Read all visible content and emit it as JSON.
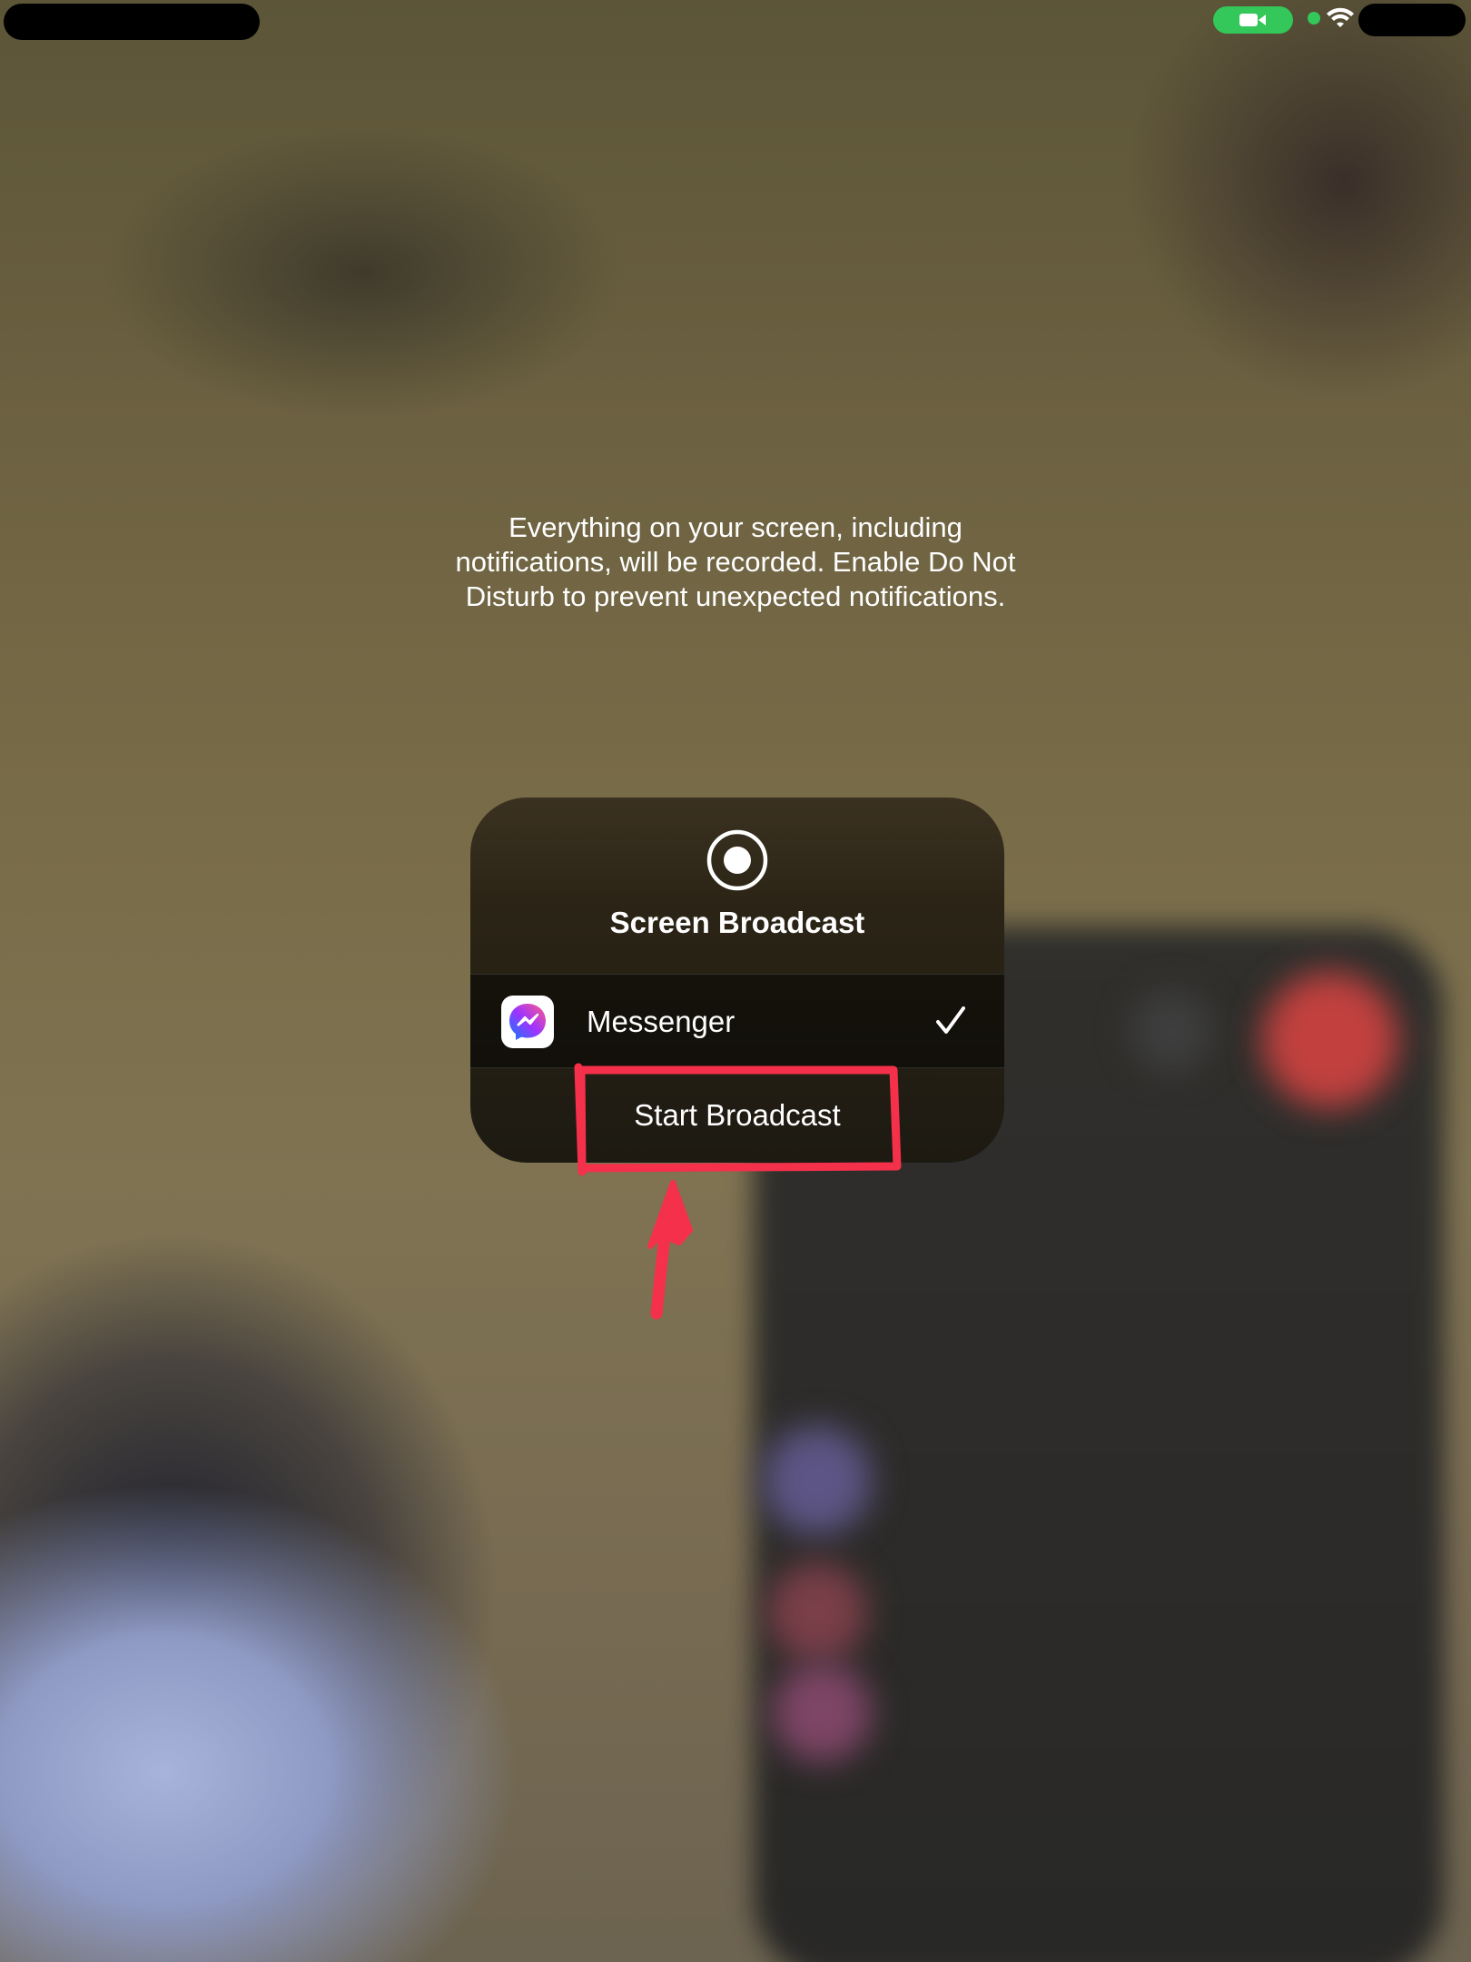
{
  "notice": {
    "text": "Everything on your screen, including notifications, will be recorded. Enable Do Not Disturb to prevent unexpected notifications."
  },
  "dialog": {
    "icon": "record-icon",
    "title": "Screen Broadcast",
    "selected_app": {
      "label": "Messenger",
      "icon": "messenger-icon",
      "selected_icon": "checkmark-icon"
    },
    "start_button_label": "Start Broadcast"
  },
  "status_bar": {
    "camera_indicator_icon": "video-camera-icon",
    "wifi_icon": "wifi-icon"
  },
  "annotations": {
    "highlight_color": "#f5304a",
    "arrow_icon": "arrow-up-icon"
  },
  "colors": {
    "status_green": "#34c759",
    "text": "#ffffff"
  }
}
